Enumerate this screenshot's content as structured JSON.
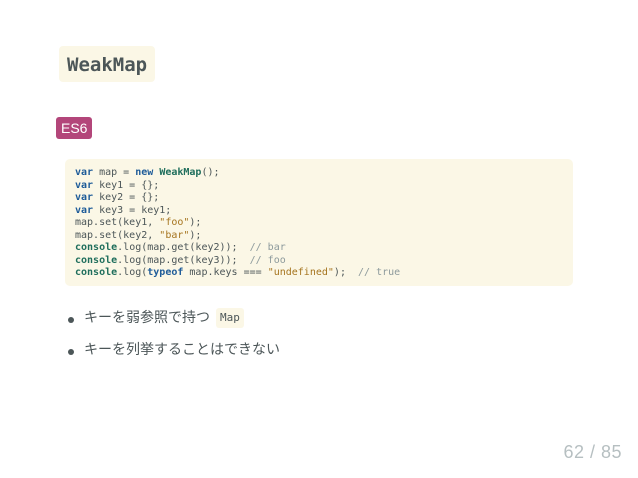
{
  "slide": {
    "title": "WeakMap",
    "badge": "ES6",
    "code": {
      "lines": [
        [
          {
            "t": "var",
            "c": "kw"
          },
          {
            "t": " map = "
          },
          {
            "t": "new",
            "c": "kw"
          },
          {
            "t": " "
          },
          {
            "t": "WeakMap",
            "c": "fn"
          },
          {
            "t": "();"
          }
        ],
        [
          {
            "t": "var",
            "c": "kw"
          },
          {
            "t": " key1 = {};"
          }
        ],
        [
          {
            "t": "var",
            "c": "kw"
          },
          {
            "t": " key2 = {};"
          }
        ],
        [
          {
            "t": "var",
            "c": "kw"
          },
          {
            "t": " key3 = key1;"
          }
        ],
        [
          {
            "t": "map.set(key1, "
          },
          {
            "t": "\"foo\"",
            "c": "str"
          },
          {
            "t": ");"
          }
        ],
        [
          {
            "t": "map.set(key2, "
          },
          {
            "t": "\"bar\"",
            "c": "str"
          },
          {
            "t": ");"
          }
        ],
        [
          {
            "t": "console",
            "c": "fn"
          },
          {
            "t": ".log(map.get(key2));  "
          },
          {
            "t": "// bar",
            "c": "cm"
          }
        ],
        [
          {
            "t": "console",
            "c": "fn"
          },
          {
            "t": ".log(map.get(key3));  "
          },
          {
            "t": "// foo",
            "c": "cm"
          }
        ],
        [
          {
            "t": "console",
            "c": "fn"
          },
          {
            "t": ".log("
          },
          {
            "t": "typeof",
            "c": "kw"
          },
          {
            "t": " map.keys === "
          },
          {
            "t": "\"undefined\"",
            "c": "str"
          },
          {
            "t": ");  "
          },
          {
            "t": "// true",
            "c": "cm"
          }
        ]
      ]
    },
    "bullets": [
      {
        "text": "キーを弱参照で持つ",
        "code": "Map"
      },
      {
        "text": "キーを列挙することはできない"
      }
    ],
    "pager": "62 / 85"
  },
  "colors": {
    "badge_bg": "#b3467a",
    "code_bg": "#fbf7e6",
    "text": "#4c5658",
    "keyword": "#1f5c99",
    "string": "#a5741e",
    "comment": "#8d9a9c",
    "pager": "#b6bfc1"
  }
}
